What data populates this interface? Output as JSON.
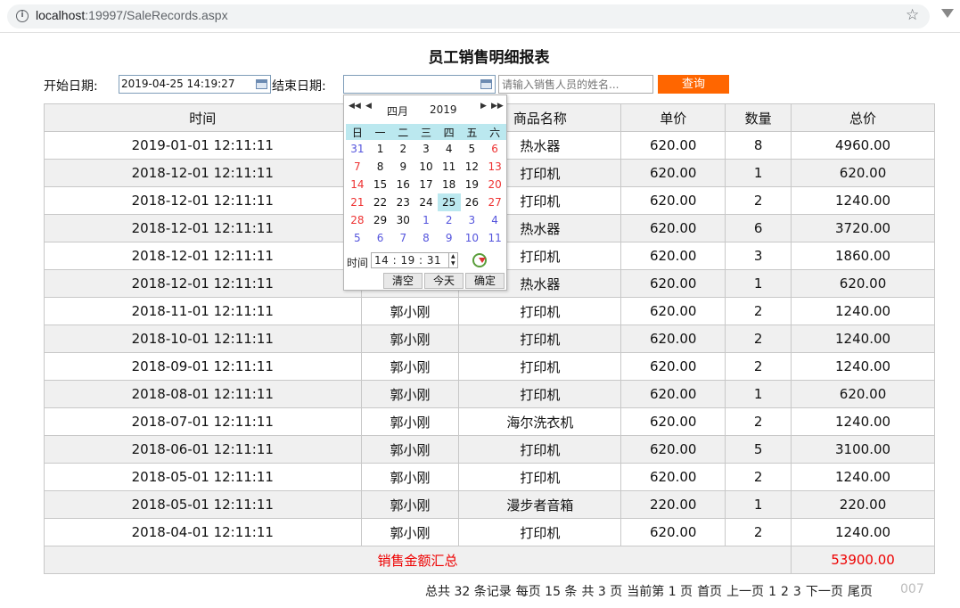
{
  "browser": {
    "url_host": "localhost",
    "url_path": ":19997/SaleRecords.aspx"
  },
  "page": {
    "title": "员工销售明细报表"
  },
  "filters": {
    "start_label": "开始日期:",
    "start_value": "2019-04-25 14:19:27",
    "end_label": "结束日期:",
    "end_value": "",
    "name_placeholder": "请输入销售人员的姓名...",
    "query_label": "查询"
  },
  "table": {
    "headers": [
      "时间",
      "",
      "商品名称",
      "单价",
      "数量",
      "总价"
    ],
    "rows": [
      [
        "2019-01-01 12:11:11",
        "",
        "热水器",
        "620.00",
        "8",
        "4960.00"
      ],
      [
        "2018-12-01 12:11:11",
        "",
        "打印机",
        "620.00",
        "1",
        "620.00"
      ],
      [
        "2018-12-01 12:11:11",
        "",
        "打印机",
        "620.00",
        "2",
        "1240.00"
      ],
      [
        "2018-12-01 12:11:11",
        "",
        "热水器",
        "620.00",
        "6",
        "3720.00"
      ],
      [
        "2018-12-01 12:11:11",
        "",
        "打印机",
        "620.00",
        "3",
        "1860.00"
      ],
      [
        "2018-12-01 12:11:11",
        "",
        "热水器",
        "620.00",
        "1",
        "620.00"
      ],
      [
        "2018-11-01 12:11:11",
        "郭小刚",
        "打印机",
        "620.00",
        "2",
        "1240.00"
      ],
      [
        "2018-10-01 12:11:11",
        "郭小刚",
        "打印机",
        "620.00",
        "2",
        "1240.00"
      ],
      [
        "2018-09-01 12:11:11",
        "郭小刚",
        "打印机",
        "620.00",
        "2",
        "1240.00"
      ],
      [
        "2018-08-01 12:11:11",
        "郭小刚",
        "打印机",
        "620.00",
        "1",
        "620.00"
      ],
      [
        "2018-07-01 12:11:11",
        "郭小刚",
        "海尔洗衣机",
        "620.00",
        "2",
        "1240.00"
      ],
      [
        "2018-06-01 12:11:11",
        "郭小刚",
        "打印机",
        "620.00",
        "5",
        "3100.00"
      ],
      [
        "2018-05-01 12:11:11",
        "郭小刚",
        "打印机",
        "620.00",
        "2",
        "1240.00"
      ],
      [
        "2018-05-01 12:11:11",
        "郭小刚",
        "漫步者音箱",
        "220.00",
        "1",
        "220.00"
      ],
      [
        "2018-04-01 12:11:11",
        "郭小刚",
        "打印机",
        "620.00",
        "2",
        "1240.00"
      ]
    ],
    "summary_label": "销售金额汇总",
    "summary_total": "53900.00"
  },
  "pager": {
    "items": [
      "总共 32 条记录",
      "每页 15 条",
      "共 3 页",
      "当前第 1 页",
      "首页",
      "上一页",
      "1",
      "2",
      "3",
      "下一页",
      "尾页"
    ]
  },
  "datepicker": {
    "month": "四月",
    "year": "2019",
    "weekdays": [
      "日",
      "一",
      "二",
      "三",
      "四",
      "五",
      "六"
    ],
    "weeks": [
      [
        31,
        1,
        2,
        3,
        4,
        5,
        6
      ],
      [
        7,
        8,
        9,
        10,
        11,
        12,
        13
      ],
      [
        14,
        15,
        16,
        17,
        18,
        19,
        20
      ],
      [
        21,
        22,
        23,
        24,
        25,
        26,
        27
      ],
      [
        28,
        29,
        30,
        1,
        2,
        3,
        4
      ],
      [
        5,
        6,
        7,
        8,
        9,
        10,
        11
      ]
    ],
    "selected_day": 25,
    "time_label": "时间",
    "time_value": "14 : 19 : 31",
    "clear_label": "清空",
    "today_label": "今天",
    "ok_label": "确定"
  }
}
